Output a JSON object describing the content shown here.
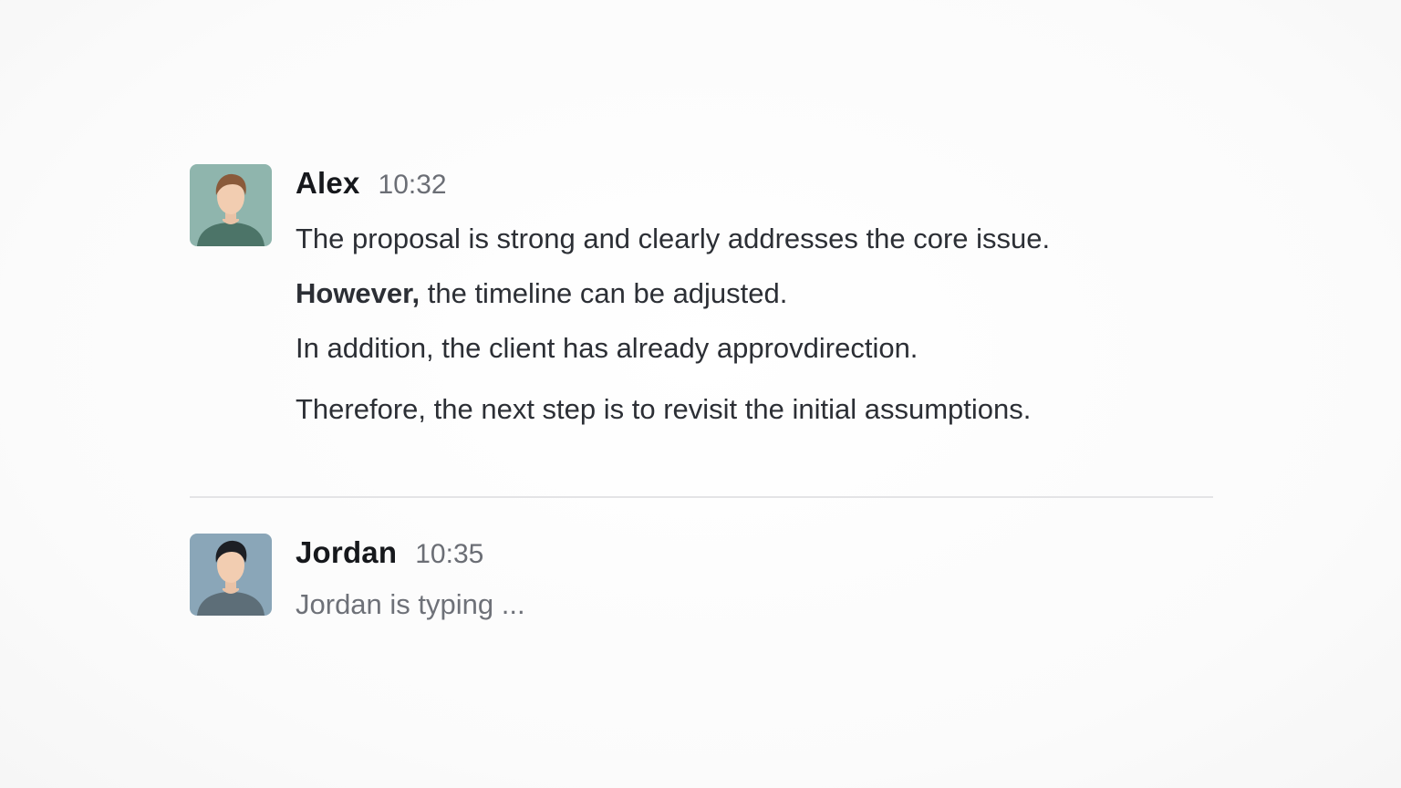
{
  "messages": [
    {
      "author": "Alex",
      "time": "10:32",
      "avatar_icon": "user-avatar-icon",
      "avatar_bg": "#8fb5ad",
      "lines": [
        {
          "bold": "",
          "text": "The proposal is strong and clearly addresses the core issue."
        },
        {
          "bold": "However,",
          "text": " the timeline can be adjusted."
        },
        {
          "bold": "",
          "text": "In addition, the client has already approvdirection."
        },
        {
          "bold": "",
          "text": "Therefore, the next step is to revisit the initial assumptions."
        }
      ]
    },
    {
      "author": "Jordan",
      "time": "10:35",
      "avatar_icon": "user-avatar-icon",
      "avatar_bg": "#8aa6b8",
      "typing": "Jordan is typing ..."
    }
  ]
}
